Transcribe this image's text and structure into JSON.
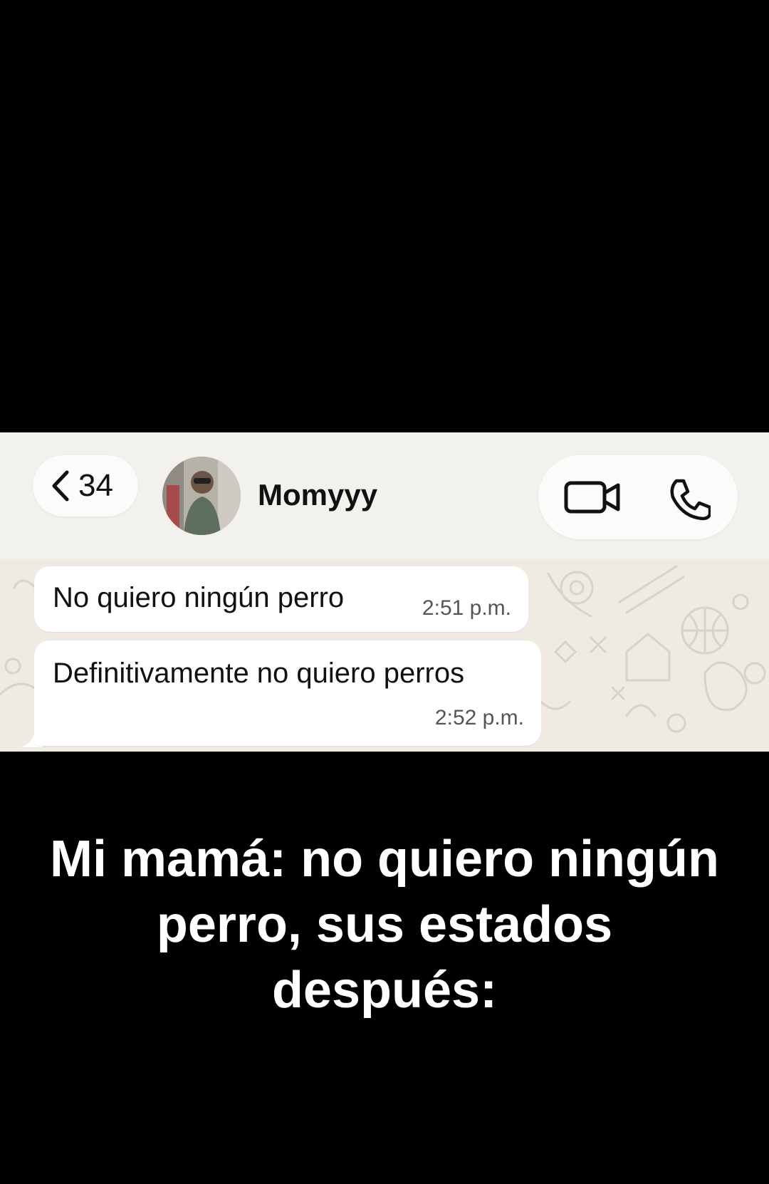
{
  "header": {
    "back_count": "34",
    "contact_name": "Momyyy"
  },
  "messages": [
    {
      "text": "No quiero ningún perro",
      "time": "2:51 p.m."
    },
    {
      "text": "Definitivamente no quiero perros",
      "time": "2:52 p.m."
    }
  ],
  "caption": "Mi mamá: no quiero ningún perro, sus estados después:",
  "icons": {
    "back": "chevron-left-icon",
    "video": "video-camera-icon",
    "call": "phone-icon"
  },
  "colors": {
    "background": "#000000",
    "chat_background": "#efeae2",
    "bubble": "#ffffff",
    "caption_text": "#ffffff"
  }
}
